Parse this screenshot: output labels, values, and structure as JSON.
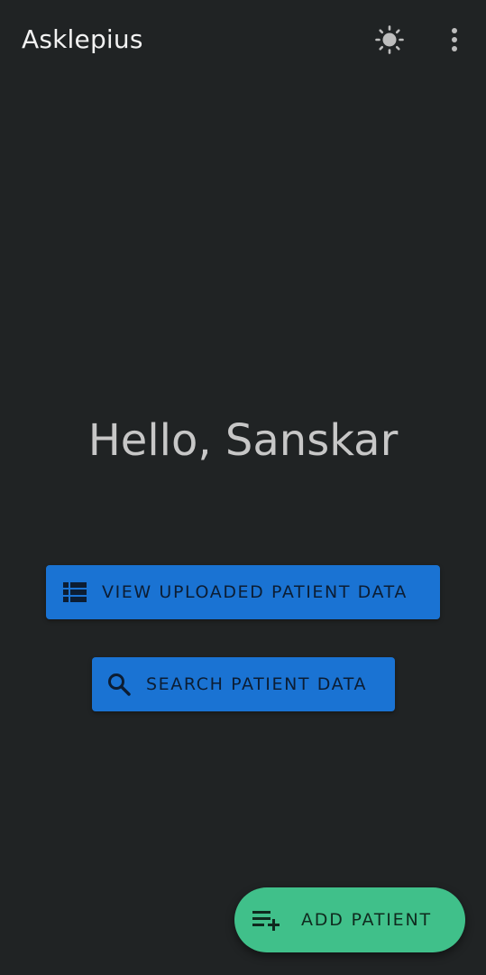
{
  "app_bar": {
    "title": "Asklepius",
    "theme_toggle_icon": "sun-icon",
    "overflow_menu_icon": "more-vert-icon"
  },
  "main": {
    "greeting": "Hello, Sanskar",
    "buttons": [
      {
        "label": "VIEW UPLOADED PATIENT DATA",
        "icon": "list-icon"
      },
      {
        "label": "SEARCH PATIENT DATA",
        "icon": "search-icon"
      }
    ]
  },
  "fab": {
    "label": "ADD PATIENT",
    "icon": "playlist-add-icon"
  },
  "colors": {
    "background": "#202324",
    "primary_button": "#1a73d3",
    "fab": "#40c08a",
    "greeting_text": "#c7c7c7"
  }
}
